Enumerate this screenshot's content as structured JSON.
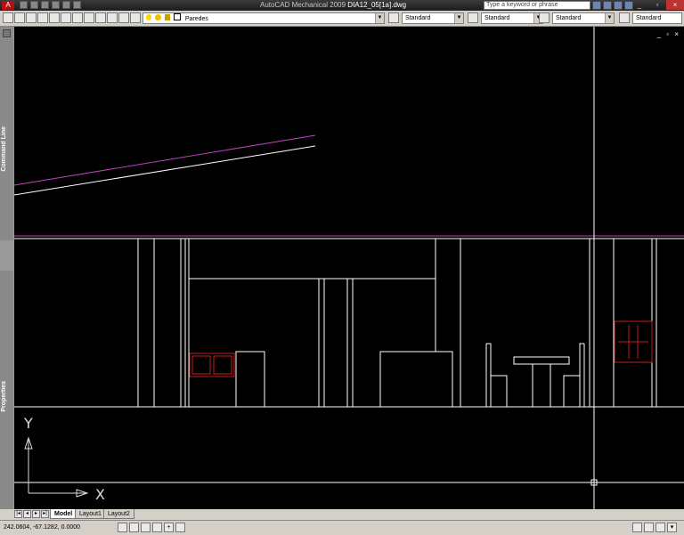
{
  "window": {
    "app_title": "AutoCAD Mechanical 2009",
    "doc_title": "DIA12_05[1a].dwg",
    "app_menu_letter": "A"
  },
  "search": {
    "placeholder": "Type a keyword or phrase"
  },
  "toolbar": {
    "layer_combo": "Paredes",
    "text_style_combo": "Standard",
    "dim_style_combo": "Standard",
    "table_style_combo": "Standard",
    "multileader_style_combo": "Standard"
  },
  "palettes": {
    "command_line_label": "Command Line",
    "properties_label": "Properties"
  },
  "viewport": {
    "controls": "_ ▫ ×",
    "ucs_y_label": "Y",
    "ucs_x_label": "X"
  },
  "layout_tabs": [
    {
      "label": "Model",
      "active": true
    },
    {
      "label": "Layout1",
      "active": false
    },
    {
      "label": "Layout2",
      "active": false
    }
  ],
  "status": {
    "coordinates": "242.0604, -67.1282, 0.0000"
  },
  "colors": {
    "canvas_bg": "#000000",
    "geometry_white": "#ffffff",
    "geometry_magenta": "#c040c0",
    "geometry_red": "#c02020",
    "crosshair": "#ffffff"
  }
}
